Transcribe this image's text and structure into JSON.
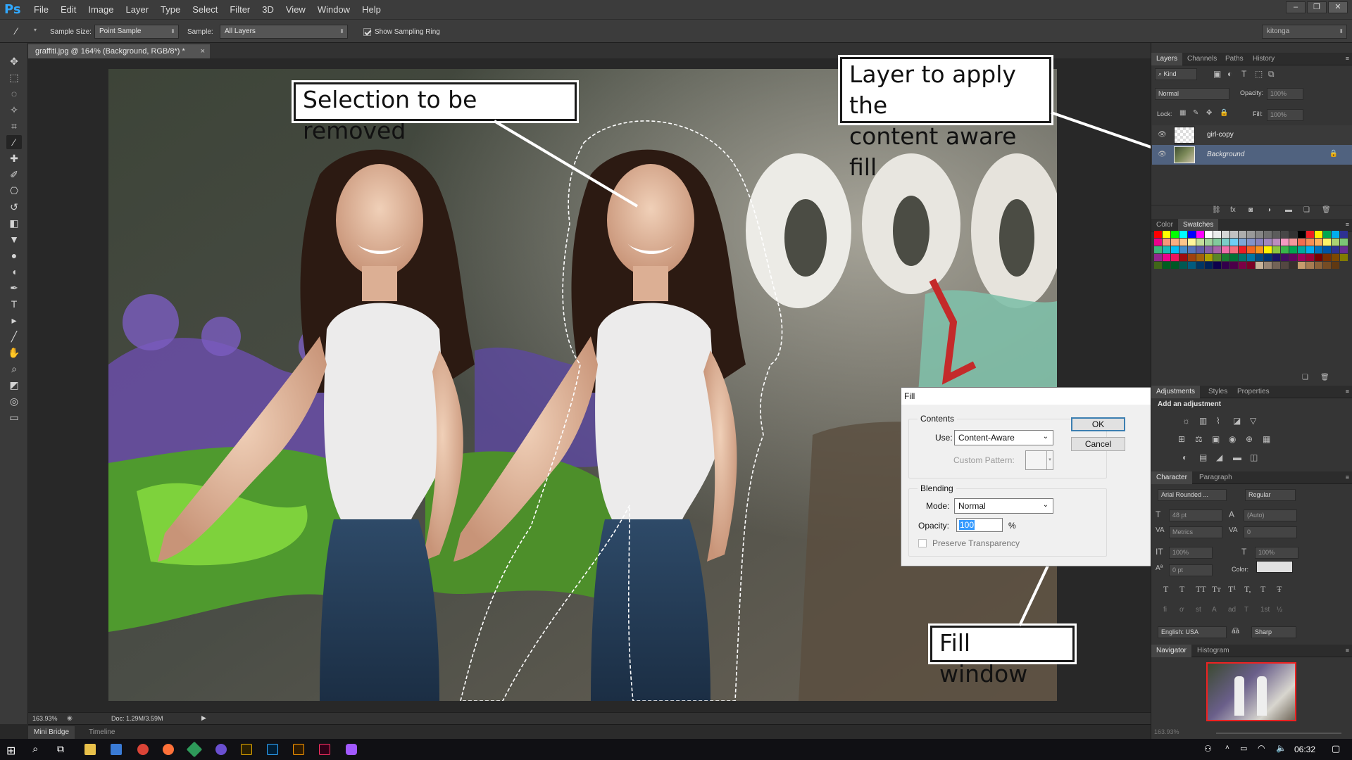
{
  "app": {
    "logo": "Ps",
    "window_controls": [
      "minimize-icon",
      "restore-icon",
      "close-icon"
    ]
  },
  "menu": [
    "File",
    "Edit",
    "Image",
    "Layer",
    "Type",
    "Select",
    "Filter",
    "3D",
    "View",
    "Window",
    "Help"
  ],
  "options": {
    "tool_icon": "eyedropper-icon",
    "sample_size_label": "Sample Size:",
    "sample_size_value": "Point Sample",
    "sample_label": "Sample:",
    "sample_value": "All Layers",
    "ring_checked": true,
    "ring_label": "Show Sampling Ring",
    "workspace": "kitonga"
  },
  "document": {
    "tab_title": "graffiti.jpg @ 164% (Background, RGB/8*) *"
  },
  "tools": [
    "move-icon",
    "marquee-icon",
    "lasso-icon",
    "quick-select-icon",
    "crop-icon",
    "eyedropper-icon",
    "healing-brush-icon",
    "brush-icon",
    "clone-stamp-icon",
    "history-brush-icon",
    "eraser-icon",
    "paint-bucket-icon",
    "blur-icon",
    "dodge-icon",
    "pen-icon",
    "type-icon",
    "path-select-icon",
    "line-icon",
    "hand-icon",
    "zoom-icon",
    "color-swatches-icon",
    "quick-mask-icon",
    "screen-mode-icon"
  ],
  "callouts": {
    "selection": "Selection to be removed",
    "layer_line1": "Layer to apply the",
    "layer_line2": "content aware fill",
    "fill_window": "Fill window"
  },
  "fill_dialog": {
    "title": "Fill",
    "contents_label": "Contents",
    "use_label": "Use:",
    "use_value": "Content-Aware",
    "custom_pattern_label": "Custom Pattern:",
    "blending_label": "Blending",
    "mode_label": "Mode:",
    "mode_value": "Normal",
    "opacity_label": "Opacity:",
    "opacity_value": "100",
    "percent": "%",
    "preserve_label": "Preserve Transparency",
    "preserve_checked": false,
    "ok": "OK",
    "cancel": "Cancel"
  },
  "layers_panel": {
    "tabs": [
      "Layers",
      "Channels",
      "Paths",
      "History"
    ],
    "kind": "Kind",
    "blend_mode": "Normal",
    "opacity_label": "Opacity:",
    "opacity_value": "100%",
    "lock_label": "Lock:",
    "fill_label": "Fill:",
    "fill_value": "100%",
    "layers": [
      {
        "name": "girl-copy",
        "visible": true,
        "selected": false
      },
      {
        "name": "Background",
        "visible": true,
        "selected": true,
        "locked": true
      }
    ]
  },
  "color_panel": {
    "tabs": [
      "Color",
      "Swatches"
    ],
    "swatches": [
      "#ff0000",
      "#ffff00",
      "#00ff00",
      "#00ffff",
      "#0000ff",
      "#ff00ff",
      "#ffffff",
      "#ebebeb",
      "#d6d6d6",
      "#c2c2c2",
      "#adadad",
      "#999999",
      "#858585",
      "#707070",
      "#5c5c5c",
      "#474747",
      "#333333",
      "#000000",
      "#ee1d24",
      "#fff100",
      "#00a650",
      "#00aeef",
      "#2e3192",
      "#ec008c",
      "#f7977a",
      "#f9ad81",
      "#fdc68a",
      "#fff79a",
      "#c4df9b",
      "#a2d39c",
      "#82ca9d",
      "#7bcdc8",
      "#6ecff6",
      "#7ea7d8",
      "#8493ca",
      "#8882be",
      "#a187be",
      "#bc8dbf",
      "#f49ac2",
      "#f6989d",
      "#f26c4f",
      "#f68e55",
      "#fbaf5c",
      "#fff467",
      "#acd372",
      "#7cc576",
      "#3bb878",
      "#1abbb4",
      "#00bff3",
      "#438ccb",
      "#5574b9",
      "#605ca8",
      "#855fa8",
      "#a763a8",
      "#f06eaa",
      "#f26d7d",
      "#ed1c24",
      "#f26522",
      "#f7941d",
      "#fff200",
      "#8dc63f",
      "#39b54a",
      "#00a651",
      "#00a99d",
      "#00aeef",
      "#0072bc",
      "#0054a6",
      "#2e3192",
      "#662d91",
      "#92278f",
      "#ec008c",
      "#ed145b",
      "#9e0b0f",
      "#a0410d",
      "#a3620a",
      "#aba000",
      "#598527",
      "#1a7b30",
      "#007236",
      "#00746b",
      "#0076a3",
      "#004b80",
      "#003471",
      "#1b1464",
      "#440e62",
      "#630460",
      "#9e005d",
      "#9e0039",
      "#790000",
      "#7b2e00",
      "#7d4900",
      "#827b00",
      "#406618",
      "#005e20",
      "#005826",
      "#005952",
      "#005b7f",
      "#003663",
      "#002157",
      "#0d004c",
      "#32004b",
      "#4b0049",
      "#7b0046",
      "#7a0026",
      "#c7b299",
      "#998675",
      "#736357",
      "#534741",
      "#37302d",
      "#c69c6d",
      "#a67c52",
      "#8c6239",
      "#754c24",
      "#603913"
    ]
  },
  "adjustments_panel": {
    "tabs": [
      "Adjustments",
      "Styles",
      "Properties"
    ],
    "heading": "Add an adjustment",
    "icons": [
      "brightness-icon",
      "levels-icon",
      "curves-icon",
      "exposure-icon",
      "vibrance-icon",
      "hue-saturation-icon",
      "color-balance-icon",
      "black-white-icon",
      "photo-filter-icon",
      "channel-mixer-icon",
      "color-lookup-icon",
      "invert-icon",
      "posterize-icon",
      "threshold-icon",
      "gradient-map-icon",
      "selective-color-icon"
    ]
  },
  "character_panel": {
    "tabs": [
      "Character",
      "Paragraph"
    ],
    "font_family": "Arial Rounded ...",
    "font_style": "Regular",
    "size": "48 pt",
    "leading": "(Auto)",
    "kerning": "Metrics",
    "tracking": "0",
    "vscale": "100%",
    "hscale": "100%",
    "baseline": "0 pt",
    "color_label": "Color:",
    "language": "English: USA",
    "aa_label": "a͡a",
    "antialias": "Sharp",
    "type_buttons": [
      "T",
      "T",
      "TT",
      "Tт",
      "T¹",
      "T,",
      "T",
      "Ŧ"
    ]
  },
  "navigator_panel": {
    "tabs": [
      "Navigator",
      "Histogram"
    ],
    "zoom": "163.93%"
  },
  "status": {
    "zoom": "163.93%",
    "doc": "Doc: 1.29M/3.59M"
  },
  "bottom_tabs": [
    "Mini Bridge",
    "Timeline"
  ],
  "taskbar": {
    "time": "06:32"
  }
}
